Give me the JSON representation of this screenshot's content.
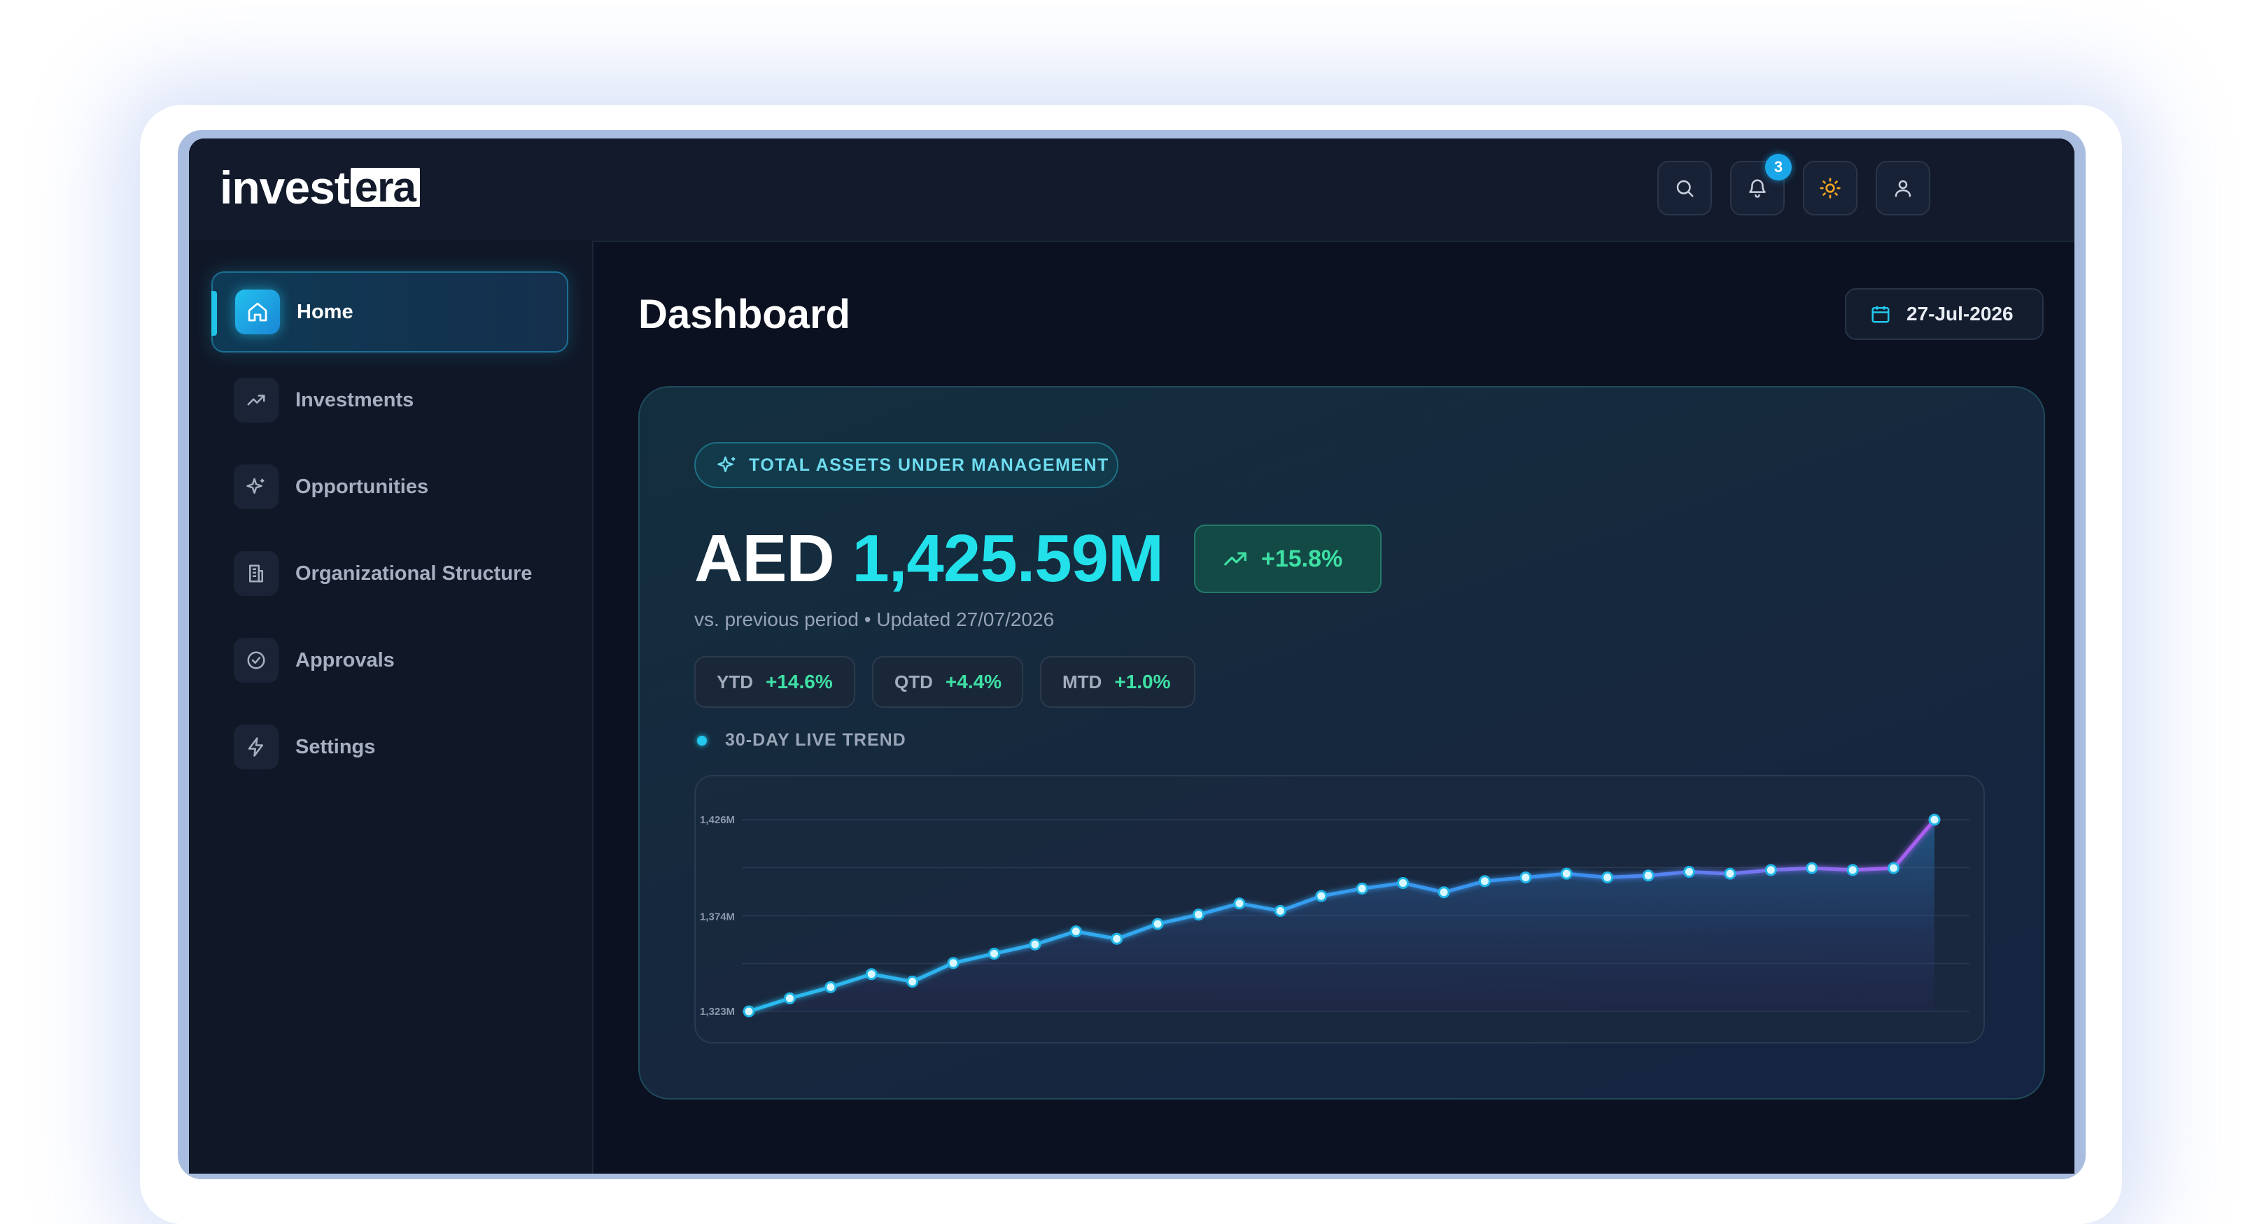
{
  "brand": {
    "logo_main": "invest",
    "logo_accent": "era"
  },
  "header": {
    "notifications_count": "3",
    "icons": [
      "search-icon",
      "bell-icon",
      "sun-icon",
      "user-icon"
    ]
  },
  "sidebar": {
    "items": [
      {
        "label": "Home",
        "icon": "home-icon",
        "active": true
      },
      {
        "label": "Investments",
        "icon": "trending-up-icon",
        "active": false
      },
      {
        "label": "Opportunities",
        "icon": "sparkles-icon",
        "active": false
      },
      {
        "label": "Organizational Structure",
        "icon": "building-icon",
        "active": false
      },
      {
        "label": "Approvals",
        "icon": "check-circle-icon",
        "active": false
      },
      {
        "label": "Settings",
        "icon": "lightning-icon",
        "active": false
      }
    ]
  },
  "main": {
    "title": "Dashboard",
    "date": "27-Jul-2026"
  },
  "aum_card": {
    "label": "TOTAL ASSETS UNDER MANAGEMENT",
    "currency": "AED",
    "value": "1,425.59M",
    "change": "+15.8%",
    "subline": "vs. previous period • Updated 27/07/2026",
    "periods": [
      {
        "label": "YTD",
        "value": "+14.6%"
      },
      {
        "label": "QTD",
        "value": "+4.4%"
      },
      {
        "label": "MTD",
        "value": "+1.0%"
      }
    ],
    "trend_label": "30-DAY LIVE TREND"
  },
  "colors": {
    "accent": "#22e1ea",
    "positive": "#3ee0a4",
    "line_start": "#2bbdf0",
    "line_end": "#b05cf0",
    "background": "#0b1120"
  },
  "chart_data": {
    "type": "area",
    "title": "30-DAY LIVE TREND",
    "y_ticks": [
      "1,426M",
      "1,374M",
      "1,323M"
    ],
    "y_tick_values": [
      1426,
      1374,
      1323
    ],
    "ylim": [
      1323,
      1426
    ],
    "grid": true,
    "series": [
      {
        "values": [
          1323,
          1330,
          1336,
          1343,
          1339,
          1349,
          1354,
          1359,
          1366,
          1362,
          1370,
          1375,
          1381,
          1377,
          1385,
          1389,
          1392,
          1387,
          1393,
          1395,
          1397,
          1395,
          1396,
          1398,
          1397,
          1399,
          1400,
          1399,
          1400,
          1426
        ]
      }
    ]
  }
}
